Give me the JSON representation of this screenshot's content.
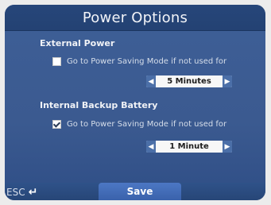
{
  "title": "Power Options",
  "external_power": {
    "section_label": "External Power",
    "checkbox_label": "Go to Power Saving Mode if not used for",
    "checked": false,
    "duration": "5 Minutes"
  },
  "internal_battery": {
    "section_label": "Internal Backup Battery",
    "checkbox_label": "Go to Power Saving Mode if not used for",
    "checked": true,
    "duration": "1 Minute"
  },
  "bottom_bar": {
    "esc_label": "ESC",
    "save_label": "Save"
  },
  "icons": {
    "left_arrow": "◀",
    "right_arrow": "▶",
    "return_arrow": "↵"
  },
  "colors": {
    "screen_bg": "#3e5f97",
    "title_bg": "#26467a",
    "accent": "#4c77c4"
  }
}
